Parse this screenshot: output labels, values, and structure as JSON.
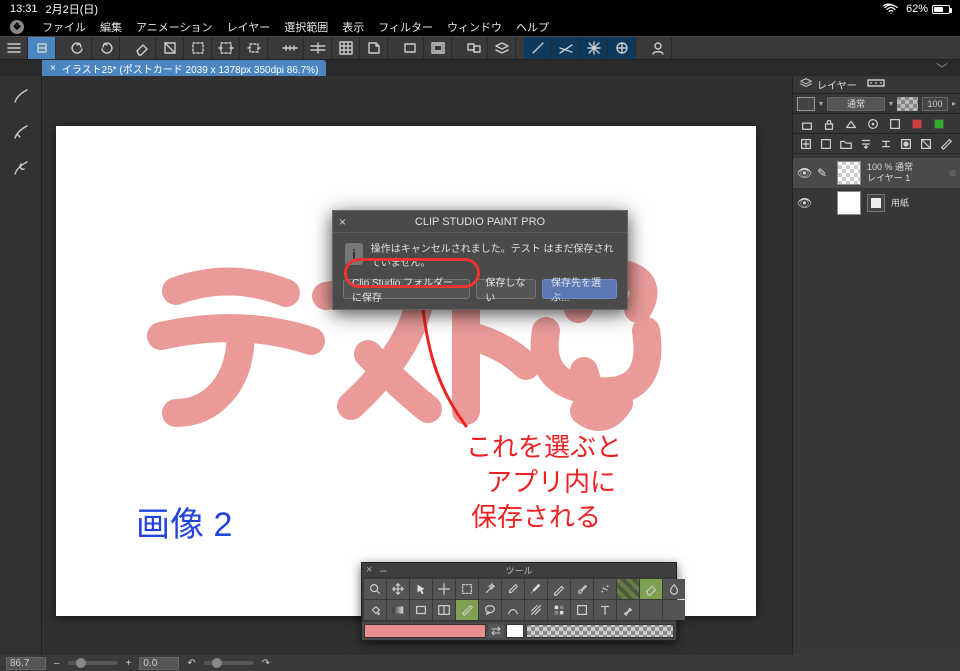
{
  "status": {
    "time": "13:31",
    "date": "2月2日(日)",
    "battery_pct": "62%"
  },
  "menu": {
    "items": [
      "ファイル",
      "編集",
      "アニメーション",
      "レイヤー",
      "選択範囲",
      "表示",
      "フィルター",
      "ウィンドウ",
      "ヘルプ"
    ]
  },
  "tab": {
    "close": "×",
    "title": "イラスト25* (ポストカード 2039 x 1378px 350dpi 86.7%)"
  },
  "canvas": {
    "word_pink": "テスト",
    "note_blue": "画像 2",
    "note_red_line1": "これを選ぶと",
    "note_red_line2": "アプリ内に",
    "note_red_line3": "保存される"
  },
  "dialog": {
    "title": "CLIP STUDIO PAINT PRO",
    "message": "操作はキャンセルされました。テスト はまだ保存されていません。",
    "btn_save_folder": "Clip Studio フォルダーに保存",
    "btn_dont_save": "保存しない",
    "btn_choose_dest": "保存先を選ぶ...",
    "close": "×",
    "info_glyph": "i"
  },
  "right_panel": {
    "tab_label": "レイヤー",
    "blend_mode": "通常",
    "opacity_value": "100",
    "layer1_top": "100 % 通常",
    "layer1_name": "レイヤー 1",
    "layer2_name": "用紙"
  },
  "float_tools": {
    "title": "ツール"
  },
  "info_bar": {
    "zoom": "86.7",
    "rotation": "0.0",
    "plus": "+",
    "minus": "–"
  }
}
